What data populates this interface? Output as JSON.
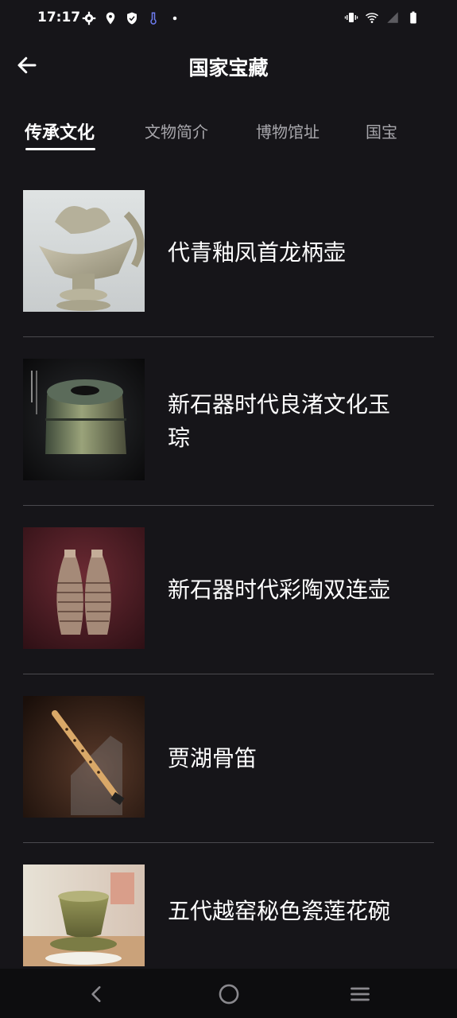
{
  "status_bar": {
    "time": "17:17",
    "left_icons": [
      "gear-icon",
      "location-icon",
      "shield-icon",
      "thermometer-icon",
      "dot-icon"
    ],
    "right_icons": [
      "vibrate-icon",
      "wifi-icon",
      "signal-icon",
      "battery-icon"
    ]
  },
  "header": {
    "back_icon": "arrow-left-icon",
    "title": "国家宝藏"
  },
  "tabs": [
    {
      "label": "传承文化",
      "active": true
    },
    {
      "label": "文物简介",
      "active": false
    },
    {
      "label": "博物馆址",
      "active": false
    },
    {
      "label": "国宝",
      "active": false
    }
  ],
  "items": [
    {
      "title": "代青釉凤首龙柄壶",
      "thumb": "celadon-phoenix-ewer"
    },
    {
      "title": "新石器时代良渚文化玉琮",
      "thumb": "liangzhu-jade-cong"
    },
    {
      "title": "新石器时代彩陶双连壶",
      "thumb": "painted-pottery-double-vase"
    },
    {
      "title": "贾湖骨笛",
      "thumb": "jiahu-bone-flute"
    },
    {
      "title": "五代越窑秘色瓷莲花碗",
      "thumb": "yue-lotus-bowl"
    }
  ],
  "nav_bar": {
    "back": "nav-back-icon",
    "home": "nav-home-icon",
    "recents": "nav-menu-icon"
  },
  "colors": {
    "background": "#161519",
    "divider": "#4a494e",
    "tab_inactive": "#a7a6ab",
    "text": "#ffffff"
  }
}
